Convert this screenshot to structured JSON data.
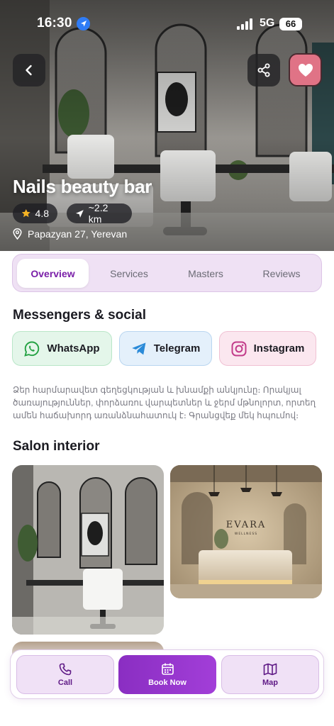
{
  "status_bar": {
    "time": "16:30",
    "network": "5G",
    "battery": "66"
  },
  "salon": {
    "name": "Nails beauty bar",
    "rating": "4.8",
    "distance": "~2.2 km",
    "address": "Papazyan 27, Yerevan",
    "favorite": true
  },
  "tabs": [
    "Overview",
    "Services",
    "Masters",
    "Reviews"
  ],
  "active_tab": "Overview",
  "messengers": {
    "heading": "Messengers & social",
    "whatsapp": "WhatsApp",
    "telegram": "Telegram",
    "instagram": "Instagram"
  },
  "description": "Ձեր հարմարավետ գեղեցկության և խնամքի անկյունը։ Որակյալ ծառայություններ, փորձառու վարպետներ և ջերմ մթնոլորտ, որտեղ ամեն հաճախորդ առանձնահատուկ է։ Գրանցվեք մեկ հպումով։",
  "gallery": {
    "heading": "Salon interior",
    "sign_text": "EVARA",
    "sign_subtext": "WELLNESS"
  },
  "bottom_bar": {
    "call": "Call",
    "book": "Book Now",
    "map": "Map"
  },
  "colors": {
    "accent": "#8a2ec2",
    "tab_bg": "#efe1f4",
    "favorite": "#e07386",
    "whatsapp": "#25a244",
    "telegram": "#2a8ad8",
    "instagram": "#c23c8a"
  }
}
